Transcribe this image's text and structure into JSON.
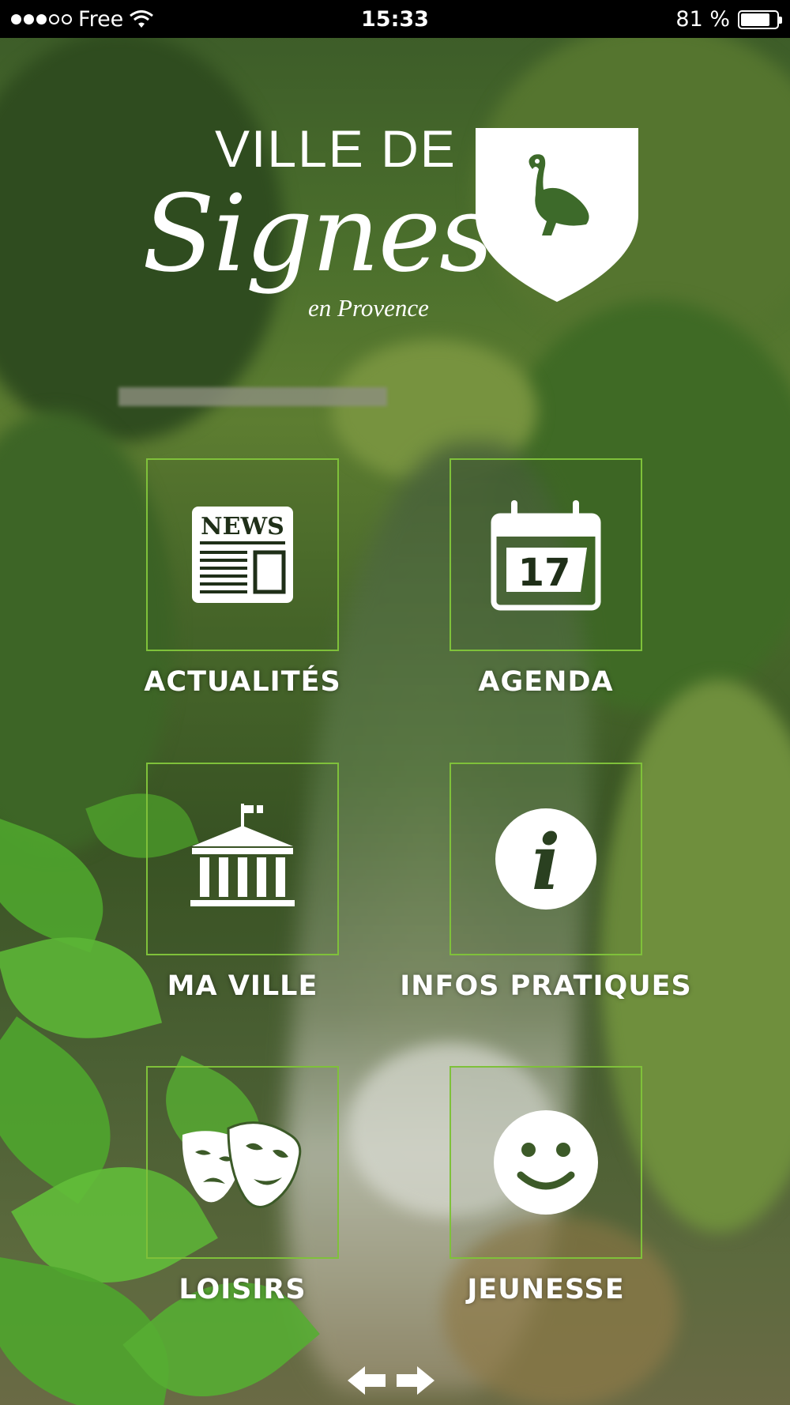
{
  "status_bar": {
    "carrier": "Free",
    "time": "15:33",
    "battery": "81 %",
    "battery_level": 0.81,
    "signal_bars_filled": 3,
    "signal_bars_total": 5
  },
  "logo": {
    "line1": "VILLE DE",
    "script": "Signes",
    "sub": "en Provence",
    "emblem": "swan-shield-icon"
  },
  "menu": [
    {
      "label": "ACTUALITÉS",
      "icon": "news-icon"
    },
    {
      "label": "AGENDA",
      "icon": "calendar-icon",
      "icon_text": "17"
    },
    {
      "label": "MA VILLE",
      "icon": "town-hall-icon"
    },
    {
      "label": "INFOS PRATIQUES",
      "icon": "info-icon",
      "icon_text": "i"
    },
    {
      "label": "LOISIRS",
      "icon": "theater-masks-icon"
    },
    {
      "label": "JEUNESSE",
      "icon": "smiley-icon"
    }
  ],
  "news_icon_text": "NEWS",
  "nav": {
    "prev": "arrow-left-icon",
    "next": "arrow-right-icon"
  },
  "colors": {
    "tile_border": "#7fc13a",
    "status_bg": "#000000",
    "text": "#ffffff"
  }
}
